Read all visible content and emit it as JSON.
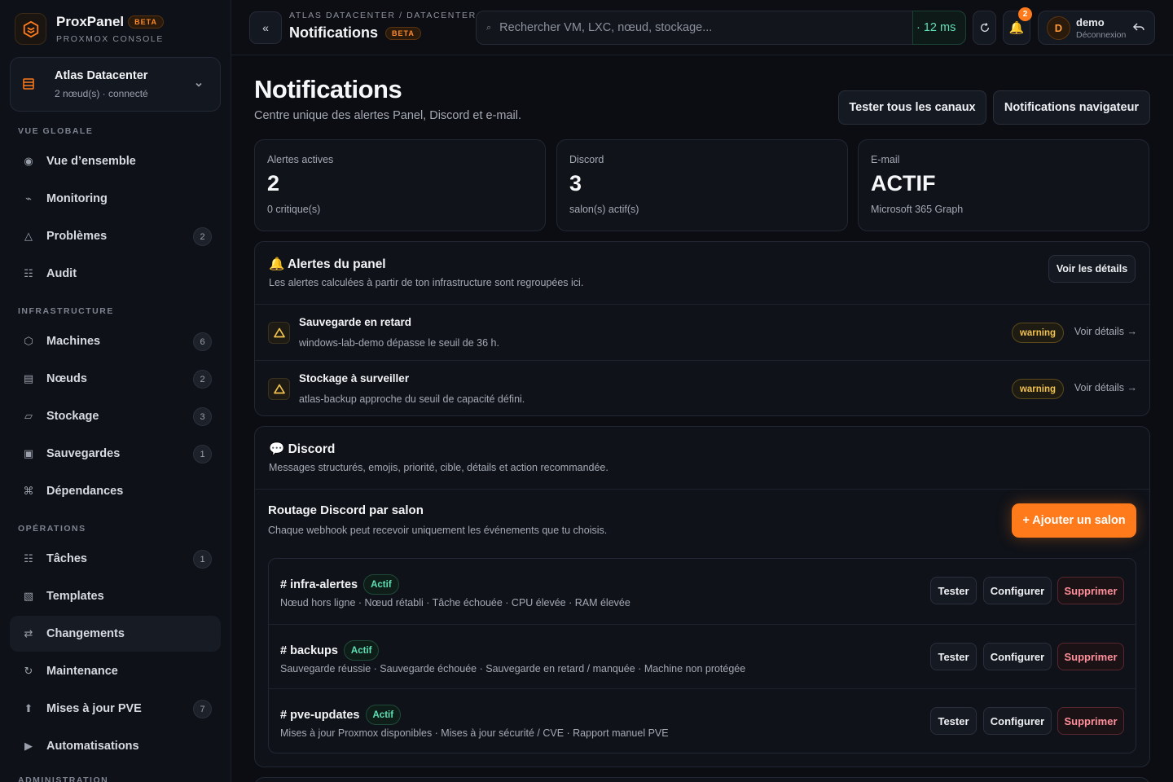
{
  "brand": {
    "name": "ProxPanel",
    "beta": "BETA",
    "subtitle": "PROXMOX CONSOLE"
  },
  "datacenter": {
    "name": "Atlas Datacenter",
    "status": "2 nœud(s) · connecté"
  },
  "sidebar": {
    "sections": [
      {
        "title": "VUE GLOBALE",
        "items": [
          {
            "label": "Vue d’ensemble",
            "icon": "overview-icon",
            "glyph": "◉"
          },
          {
            "label": "Monitoring",
            "icon": "monitoring-icon",
            "glyph": "⌁"
          },
          {
            "label": "Problèmes",
            "icon": "warning-icon",
            "glyph": "△",
            "badge": "2"
          },
          {
            "label": "Audit",
            "icon": "audit-icon",
            "glyph": "☷"
          }
        ]
      },
      {
        "title": "INFRASTRUCTURE",
        "items": [
          {
            "label": "Machines",
            "icon": "machine-icon",
            "glyph": "⬡",
            "badge": "6"
          },
          {
            "label": "Nœuds",
            "icon": "node-icon",
            "glyph": "▤",
            "badge": "2"
          },
          {
            "label": "Stockage",
            "icon": "storage-icon",
            "glyph": "▱",
            "badge": "3"
          },
          {
            "label": "Sauvegardes",
            "icon": "backup-icon",
            "glyph": "▣",
            "badge": "1"
          },
          {
            "label": "Dépendances",
            "icon": "dependency-icon",
            "glyph": "⌘"
          }
        ]
      },
      {
        "title": "OPÉRATIONS",
        "items": [
          {
            "label": "Tâches",
            "icon": "tasks-icon",
            "glyph": "☷",
            "badge": "1"
          },
          {
            "label": "Templates",
            "icon": "template-icon",
            "glyph": "▧"
          },
          {
            "label": "Changements",
            "icon": "changes-icon",
            "glyph": "⇄",
            "active": true
          },
          {
            "label": "Maintenance",
            "icon": "maintenance-icon",
            "glyph": "↻"
          },
          {
            "label": "Mises à jour PVE",
            "icon": "update-icon",
            "glyph": "⬆",
            "badge": "7"
          },
          {
            "label": "Automatisations",
            "icon": "automation-icon",
            "glyph": "▶"
          }
        ]
      },
      {
        "title": "ADMINISTRATION",
        "items": []
      }
    ]
  },
  "topbar": {
    "breadcrumb": "ATLAS DATACENTER / DATACENTER",
    "title": "Notifications",
    "beta": "BETA",
    "search_placeholder": "Rechercher VM, LXC, nœud, stockage...",
    "latency": "· 12 ms",
    "notif_count": "2",
    "user": {
      "initial": "D",
      "name": "demo",
      "action": "Déconnexion"
    }
  },
  "page": {
    "title": "Notifications",
    "subtitle": "Centre unique des alertes Panel, Discord et e-mail.",
    "test_all_label": "Tester tous les canaux",
    "browser_notif_label": "Notifications navigateur"
  },
  "stats": [
    {
      "label": "Alertes actives",
      "value": "2",
      "sub": "0 critique(s)"
    },
    {
      "label": "Discord",
      "value": "3",
      "sub": "salon(s) actif(s)"
    },
    {
      "label": "E-mail",
      "value": "ACTIF",
      "sub": "Microsoft 365 Graph"
    }
  ],
  "alerts_panel": {
    "title": "🔔 Alertes du panel",
    "subtitle": "Les alertes calculées à partir de ton infrastructure sont regroupées ici.",
    "details_label": "Voir les détails",
    "items": [
      {
        "title": "Sauvegarde en retard",
        "desc": "windows-lab-demo dépasse le seuil de 36 h.",
        "level": "warning",
        "link": "Voir détails →"
      },
      {
        "title": "Stockage à surveiller",
        "desc": "atlas-backup approche du seuil de capacité défini.",
        "level": "warning",
        "link": "Voir détails →"
      }
    ]
  },
  "discord_panel": {
    "title": "💬 Discord",
    "subtitle": "Messages structurés, emojis, priorité, cible, détails et action recommandée.",
    "routing_title": "Routage Discord par salon",
    "routing_sub": "Chaque webhook peut recevoir uniquement les événements que tu choisis.",
    "add_label": "+ Ajouter un salon",
    "channels": [
      {
        "name": "# infra-alertes",
        "status": "Actif",
        "events": "Nœud hors ligne · Nœud rétabli · Tâche échouée · CPU élevée · RAM élevée"
      },
      {
        "name": "# backups",
        "status": "Actif",
        "events": "Sauvegarde réussie · Sauvegarde échouée · Sauvegarde en retard / manquée · Machine non protégée"
      },
      {
        "name": "# pve-updates",
        "status": "Actif",
        "events": "Mises à jour Proxmox disponibles · Mises à jour sécurité / CVE · Rapport manuel PVE"
      }
    ],
    "actions": {
      "test": "Tester",
      "configure": "Configurer",
      "delete": "Supprimer"
    }
  },
  "colors": {
    "accent": "#ff7a1a",
    "success": "#5fe0b4",
    "warning": "#f2c24e",
    "danger": "#ff8f9b"
  }
}
